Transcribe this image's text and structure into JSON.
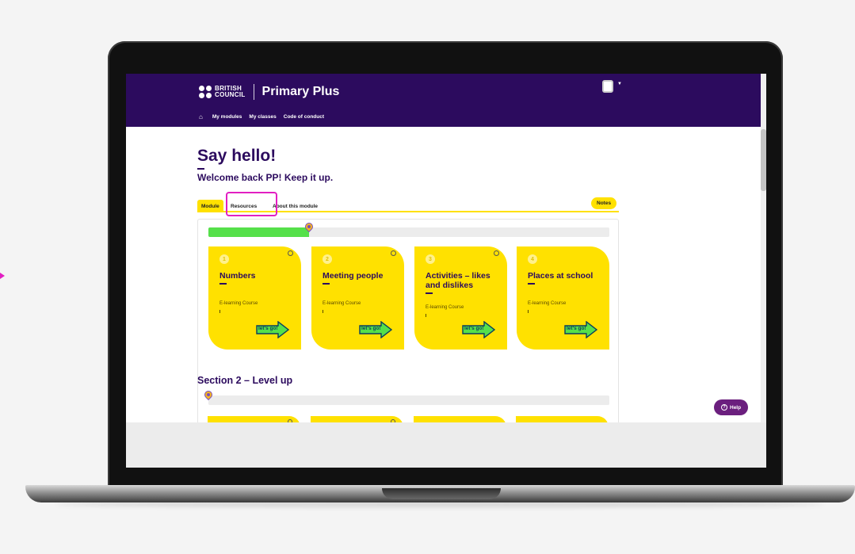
{
  "header": {
    "logo_line1": "BRITISH",
    "logo_line2": "COUNCIL",
    "product": "Primary Plus",
    "nav": [
      "My modules",
      "My classes",
      "Code of conduct"
    ]
  },
  "page": {
    "title": "Say hello!",
    "subtitle": "Welcome back PP! Keep it up."
  },
  "tabs": {
    "module": "Module",
    "resources": "Resources",
    "about": "About this module",
    "notes": "Notes"
  },
  "section1": {
    "progress_fraction": 0.25,
    "cards": [
      {
        "num": "1",
        "title": "Numbers",
        "type": "E-learning Course",
        "cta": "let's go!"
      },
      {
        "num": "2",
        "title": "Meeting people",
        "type": "E-learning Course",
        "cta": "let's go!"
      },
      {
        "num": "3",
        "title": "Activities – likes and dislikes",
        "type": "E-learning Course",
        "cta": "let's go!"
      },
      {
        "num": "4",
        "title": "Places at school",
        "type": "E-learning Course",
        "cta": "let's go!"
      }
    ]
  },
  "section2": {
    "title": "Section 2 – Level up",
    "progress_fraction": 0.0
  },
  "help": {
    "label": "Help"
  },
  "colors": {
    "brand": "#2c0b5e",
    "accent": "#ffe100",
    "progress": "#55e04a",
    "highlight": "#e21fc2",
    "help": "#6b1f7e"
  },
  "icons": {
    "home": "home-icon",
    "user": "user-avatar-icon",
    "help": "question-icon",
    "pin": "map-pin-icon",
    "go": "arrow-right-icon"
  }
}
